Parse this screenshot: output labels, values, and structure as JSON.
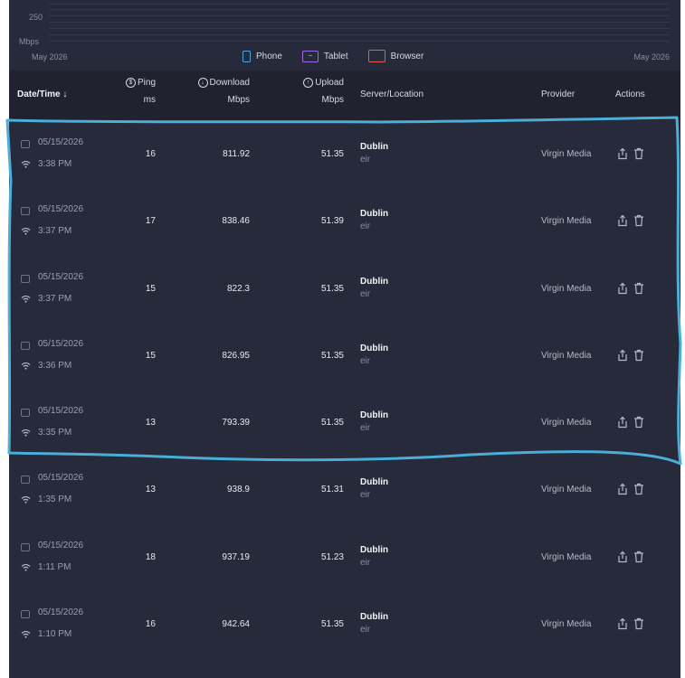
{
  "chart": {
    "y_tick": "250",
    "y_unit": "Mbps",
    "x_start": "May 2026",
    "x_end": "May 2026",
    "legend": [
      {
        "label": "Phone",
        "icon": "phone-icon",
        "color": "#4aa6e8"
      },
      {
        "label": "Tablet",
        "icon": "tablet-icon",
        "color": "#9b6be0"
      },
      {
        "label": "Browser",
        "icon": "browser-icon",
        "color": "#e85d4a"
      }
    ]
  },
  "table": {
    "headers": {
      "date": "Date/Time ↓",
      "ping": "Ping",
      "ping_unit": "ms",
      "download": "Download",
      "download_unit": "Mbps",
      "upload": "Upload",
      "upload_unit": "Mbps",
      "server": "Server/Location",
      "provider": "Provider",
      "actions": "Actions"
    },
    "rows": [
      {
        "date": "05/15/2026",
        "time": "3:38 PM",
        "ping": "16",
        "download": "811.92",
        "upload": "51.35",
        "server": "Dublin",
        "isp": "eir",
        "provider": "Virgin Media"
      },
      {
        "date": "05/15/2026",
        "time": "3:37 PM",
        "ping": "17",
        "download": "838.46",
        "upload": "51.39",
        "server": "Dublin",
        "isp": "eir",
        "provider": "Virgin Media"
      },
      {
        "date": "05/15/2026",
        "time": "3:37 PM",
        "ping": "15",
        "download": "822.3",
        "upload": "51.35",
        "server": "Dublin",
        "isp": "eir",
        "provider": "Virgin Media"
      },
      {
        "date": "05/15/2026",
        "time": "3:36 PM",
        "ping": "15",
        "download": "826.95",
        "upload": "51.35",
        "server": "Dublin",
        "isp": "eir",
        "provider": "Virgin Media"
      },
      {
        "date": "05/15/2026",
        "time": "3:35 PM",
        "ping": "13",
        "download": "793.39",
        "upload": "51.35",
        "server": "Dublin",
        "isp": "eir",
        "provider": "Virgin Media"
      },
      {
        "date": "05/15/2026",
        "time": "1:35 PM",
        "ping": "13",
        "download": "938.9",
        "upload": "51.31",
        "server": "Dublin",
        "isp": "eir",
        "provider": "Virgin Media"
      },
      {
        "date": "05/15/2026",
        "time": "1:11 PM",
        "ping": "18",
        "download": "937.19",
        "upload": "51.23",
        "server": "Dublin",
        "isp": "eir",
        "provider": "Virgin Media"
      },
      {
        "date": "05/15/2026",
        "time": "1:10 PM",
        "ping": "16",
        "download": "942.64",
        "upload": "51.35",
        "server": "Dublin",
        "isp": "eir",
        "provider": "Virgin Media"
      }
    ]
  },
  "colors": {
    "panel_bg": "#272a3a",
    "header_bg": "#20222f",
    "annotation": "#4aaed8"
  }
}
